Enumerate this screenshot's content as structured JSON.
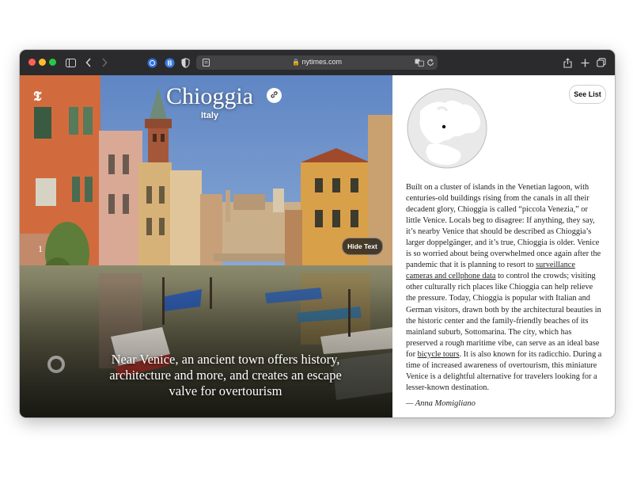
{
  "browser": {
    "url": "nytimes.com"
  },
  "slide": {
    "title": "Chioggia",
    "country": "Italy",
    "slide_number": "1",
    "hide_text_label": "Hide Text",
    "caption": "Near Venice, an ancient town offers history, architecture and more, and creates an escape valve for overtourism"
  },
  "article": {
    "see_list_label": "See List",
    "p1": "Built on a cluster of islands in the Venetian lagoon, with centuries-old buildings rising from the canals in all their decadent glory, Chioggia is called “piccola Venezia,” or little Venice. Locals beg to disagree: If anything, they say, it’s nearby Venice that should be described as Chioggia’s larger doppelgänger, and it’s true, Chioggia is older. Venice is so worried about being overwhelmed once again after the pandemic that it is planning to resort to ",
    "link1": "surveillance cameras and cellphone data",
    "p2": " to control the crowds; visiting other culturally rich places like Chioggia can help relieve the pressure. Today, Chioggia is popular with Italian and German visitors, drawn both by the architectural beauties in the historic center and the family-friendly beaches of its mainland suburb, Sottomarina. The city, which has preserved a rough maritime vibe, can serve as an ideal base for ",
    "link2": "bicycle tours",
    "p3": ". It is also known for its radicchio. During a time of increased awareness of overtourism, this miniature Venice is a delightful alternative for travelers looking for a lesser-known destination.",
    "author": "— Anna Momigliano"
  },
  "colors": {
    "toolbar": "#2b2b2d",
    "close": "#fe5f57",
    "minimize": "#febc2e",
    "maximize": "#28c840"
  },
  "icons": {
    "logo": "nyt-logo",
    "map": "europe-globe-map"
  }
}
